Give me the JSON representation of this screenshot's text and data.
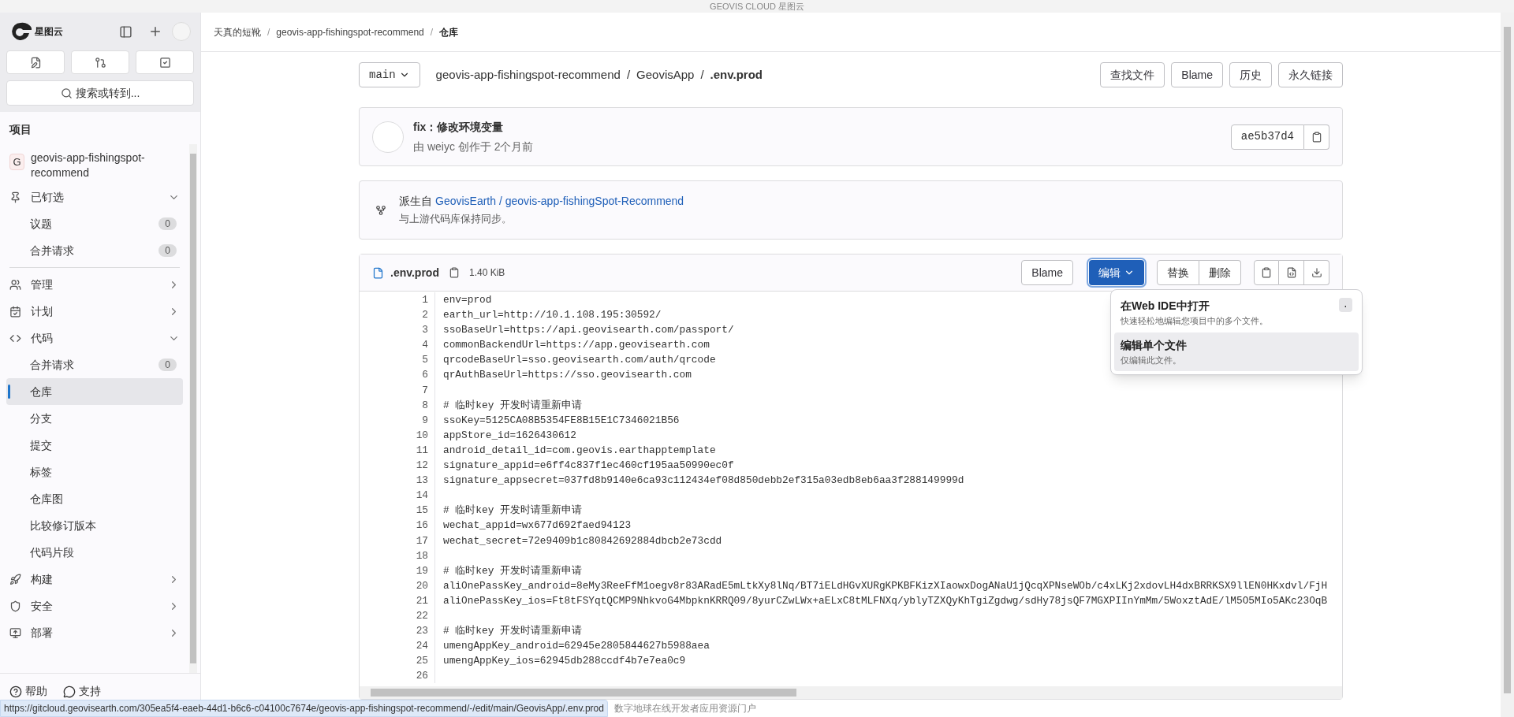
{
  "window": {
    "title": "GEOVIS CLOUD 星图云"
  },
  "sidebar": {
    "logo_text": "星图云",
    "search": {
      "placeholder": "搜索或转到..."
    },
    "section_title": "项目",
    "project": {
      "initial": "G",
      "name": "geovis-app-fishingspot-recommend"
    },
    "items": [
      {
        "label": "已钉选",
        "expanded": true,
        "children": [
          {
            "label": "议题",
            "count": "0",
            "selected": false
          },
          {
            "label": "合并请求",
            "count": "0",
            "selected": false
          }
        ]
      },
      {
        "label": "管理",
        "expanded": false
      },
      {
        "label": "计划",
        "expanded": false
      },
      {
        "label": "代码",
        "expanded": true,
        "children": [
          {
            "label": "合并请求",
            "count": "0",
            "selected": false
          },
          {
            "label": "仓库",
            "selected": true
          },
          {
            "label": "分支",
            "selected": false
          },
          {
            "label": "提交",
            "selected": false
          },
          {
            "label": "标签",
            "selected": false
          },
          {
            "label": "仓库图",
            "selected": false
          },
          {
            "label": "比较修订版本",
            "selected": false
          },
          {
            "label": "代码片段",
            "selected": false
          }
        ]
      },
      {
        "label": "构建",
        "expanded": false
      },
      {
        "label": "安全",
        "expanded": false
      },
      {
        "label": "部署",
        "expanded": false
      }
    ],
    "footer": [
      "帮助",
      "支持"
    ]
  },
  "breadcrumb": [
    "天真的短靴",
    "geovis-app-fishingspot-recommend",
    "仓库"
  ],
  "breadcrumb_separator": "/",
  "file_nav": {
    "branch": "main",
    "separator": "/",
    "path": [
      "geovis-app-fishingspot-recommend",
      "GeovisApp",
      ".env.prod"
    ],
    "buttons": [
      "查找文件",
      "Blame",
      "历史",
      "永久链接"
    ]
  },
  "commit": {
    "title": "fix：修改环境变量",
    "meta": "由 weiyc 创作于 2个月前",
    "sha": "ae5b37d4"
  },
  "fork": {
    "label": "派生自",
    "link": "GeovisEarth / geovis-app-fishingSpot-Recommend",
    "status": "与上游代码库保持同步。"
  },
  "file": {
    "name": ".env.prod",
    "size": "1.40 KiB",
    "blame": "Blame",
    "edit": {
      "label": "编辑",
      "expanded": true
    },
    "actions": [
      "替换",
      "删除"
    ],
    "menu": [
      {
        "title": "在Web IDE中打开",
        "description": "快速轻松地编辑您项目中的多个文件。",
        "shortcut": ".",
        "selected": false
      },
      {
        "title": "编辑单个文件",
        "description": "仅编辑此文件。",
        "selected": true
      }
    ],
    "lines": [
      {
        "n": "1",
        "text": "env=prod"
      },
      {
        "n": "2",
        "text": "earth_url=http://10.1.108.195:30592/"
      },
      {
        "n": "3",
        "text": "ssoBaseUrl=https://api.geovisearth.com/passport/"
      },
      {
        "n": "4",
        "text": "commonBackendUrl=https://app.geovisearth.com"
      },
      {
        "n": "5",
        "text": "qrcodeBaseUrl=sso.geovisearth.com/auth/qrcode"
      },
      {
        "n": "6",
        "text": "qrAuthBaseUrl=https://sso.geovisearth.com"
      },
      {
        "n": "7"
      },
      {
        "n": "8",
        "text": "# 临时key 开发时请重新申请"
      },
      {
        "n": "9",
        "text": "ssoKey=5125CA08B5354FE8B15E1C7346021B56"
      },
      {
        "n": "10",
        "text": "appStore_id=1626430612"
      },
      {
        "n": "11",
        "text": "android_detail_id=com.geovis.earthapptemplate"
      },
      {
        "n": "12",
        "text": "signature_appid=e6ff4c837f1ec460cf195aa50990ec0f"
      },
      {
        "n": "13",
        "text": "signature_appsecret=037fd8b9140e6ca93c112434ef08d850debb2ef315a03edb8eb6aa3f288149999d"
      },
      {
        "n": "14"
      },
      {
        "n": "15",
        "text": "# 临时key 开发时请重新申请"
      },
      {
        "n": "16",
        "text": "wechat_appid=wx677d692faed94123"
      },
      {
        "n": "17",
        "text": "wechat_secret=72e9409b1c80842692884dbcb2e73cdd"
      },
      {
        "n": "18"
      },
      {
        "n": "19",
        "text": "# 临时key 开发时请重新申请"
      },
      {
        "n": "20",
        "text": "aliOnePassKey_android=8eMy3ReeFfM1oegv8r83ARadE5mLtkXy8lNq/BT7iELdHGvXURgKPKBFKizXIaowxDogANaU1jQcqXPNseWOb/c4xLKj2xdovLH4dxBRRKSX9llEN0HKxdvl/FjH"
      },
      {
        "n": "21",
        "text": "aliOnePassKey_ios=Ft8tFSYqtQCMP9NhkvoG4MbpknKRRQ09/8yurCZwLWx+aELxC8tMLFNXq/yblyTZXQyKhTgiZgdwg/sdHy78jsQF7MGXPIInYmMm/5WoxztAdE/lM5O5MIo5AKc23OqB"
      },
      {
        "n": "22"
      },
      {
        "n": "23",
        "text": "# 临时key 开发时请重新申请"
      },
      {
        "n": "24",
        "text": "umengAppKey_android=62945e2805844627b5988aea"
      },
      {
        "n": "25",
        "text": "umengAppKey_ios=62945db288ccdf4b7e7ea0c9"
      },
      {
        "n": "26"
      }
    ]
  },
  "status_bar": {
    "url": "https://gitcloud.geovisearth.com/305ea5f4-eaeb-44d1-b6c6-c04100c7674e/geovis-app-fishingspot-recommend/-/edit/main/GeovisApp/.env.prod",
    "footer": "数字地球在线开发者应用资源门户"
  }
}
